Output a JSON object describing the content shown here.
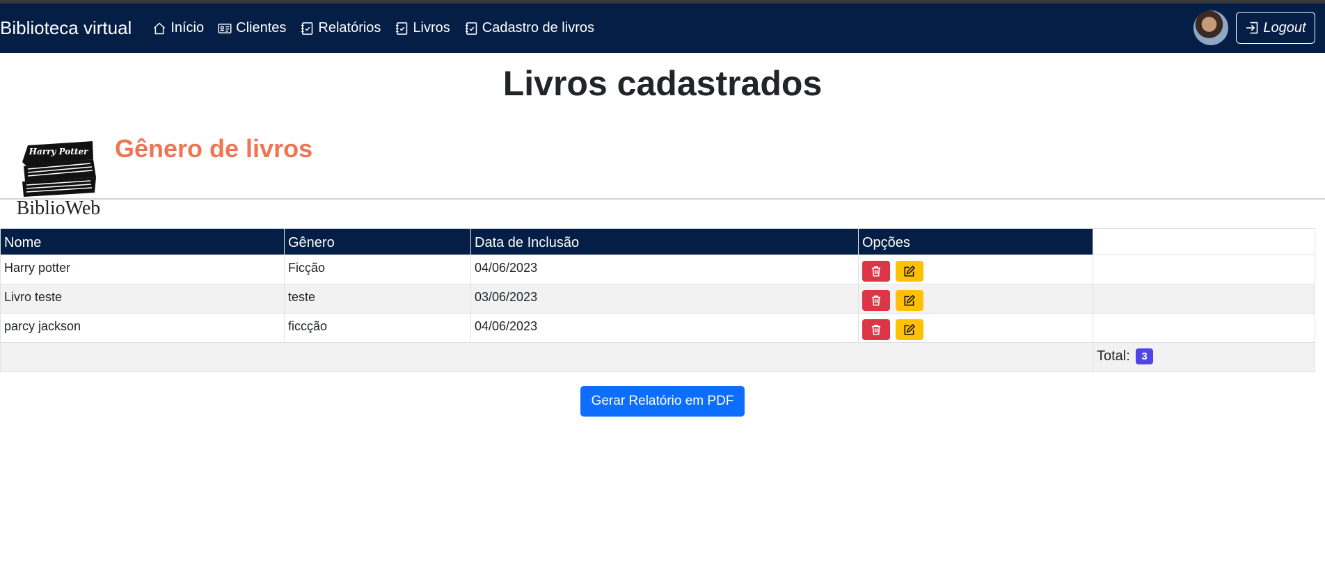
{
  "nav": {
    "brand": "Biblioteca virtual",
    "items": [
      {
        "label": "Início",
        "icon": "house-icon"
      },
      {
        "label": "Clientes",
        "icon": "id-card-icon"
      },
      {
        "label": "Relatórios",
        "icon": "journal-check-icon"
      },
      {
        "label": "Livros",
        "icon": "journal-check-icon"
      },
      {
        "label": "Cadastro de livros",
        "icon": "journal-check-icon"
      }
    ],
    "logout": "Logout"
  },
  "page": {
    "title": "Livros cadastrados",
    "genre_heading": "Gênero de livros",
    "logo": {
      "banner_text": "Harry Potter",
      "name": "BiblioWeb"
    }
  },
  "table": {
    "headers": [
      "Nome",
      "Gênero",
      "Data de Inclusão",
      "Opções"
    ],
    "rows": [
      {
        "nome": "Harry potter",
        "genero": "Ficção",
        "data": "04/06/2023"
      },
      {
        "nome": "Livro teste",
        "genero": "teste",
        "data": "03/06/2023"
      },
      {
        "nome": "parcy jackson",
        "genero": "ficcção",
        "data": "04/06/2023"
      }
    ],
    "total_label": "Total:",
    "total_count": "3"
  },
  "actions": {
    "pdf_button": "Gerar Relatório em PDF"
  },
  "colors": {
    "navbar": "#051e45",
    "accent_title": "#ee7452",
    "delete": "#dc3545",
    "edit": "#ffc107",
    "primary": "#0d6efd",
    "badge": "#4f46e5"
  }
}
